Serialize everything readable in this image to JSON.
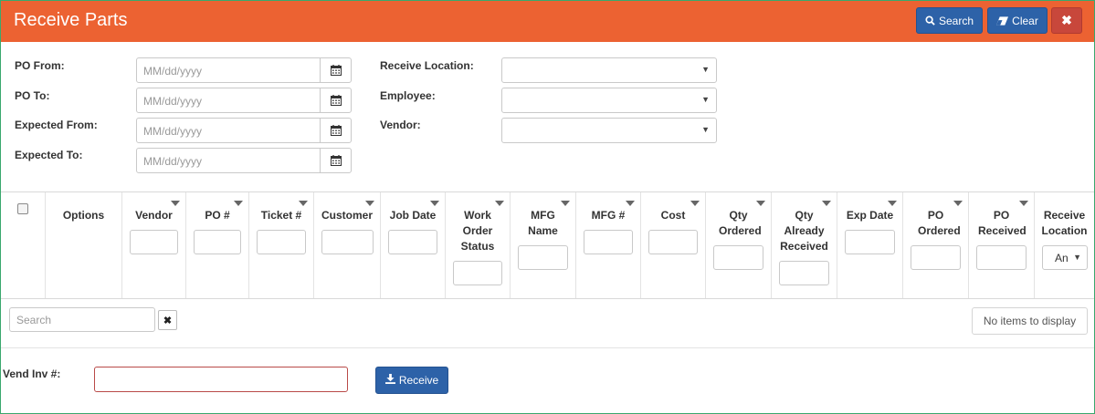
{
  "header": {
    "title": "Receive Parts",
    "search_label": "Search",
    "clear_label": "Clear",
    "close_glyph": "✖",
    "accent": "#ec6232"
  },
  "filters": {
    "po_from": {
      "label": "PO From:",
      "placeholder": "MM/dd/yyyy"
    },
    "po_to": {
      "label": "PO To:",
      "placeholder": "MM/dd/yyyy"
    },
    "expected_from": {
      "label": "Expected From:",
      "placeholder": "MM/dd/yyyy"
    },
    "expected_to": {
      "label": "Expected To:",
      "placeholder": "MM/dd/yyyy"
    },
    "receive_location": {
      "label": "Receive Location:",
      "value": ""
    },
    "employee": {
      "label": "Employee:",
      "value": ""
    },
    "vendor": {
      "label": "Vendor:",
      "value": ""
    }
  },
  "grid": {
    "columns": [
      {
        "label": "Options"
      },
      {
        "label": "Vendor"
      },
      {
        "label": "PO #"
      },
      {
        "label": "Ticket #"
      },
      {
        "label": "Customer"
      },
      {
        "label": "Job Date"
      },
      {
        "label": "Work Order Status"
      },
      {
        "label": "MFG Name"
      },
      {
        "label": "MFG #"
      },
      {
        "label": "Cost"
      },
      {
        "label": "Qty Ordered"
      },
      {
        "label": "Qty Already Received"
      },
      {
        "label": "Exp Date"
      },
      {
        "label": "PO Ordered"
      },
      {
        "label": "PO Received"
      },
      {
        "label": "Receive Location"
      }
    ],
    "receive_location_filter_value": "An",
    "search_placeholder": "Search",
    "clear_glyph": "✖",
    "empty_message": "No items to display"
  },
  "footer": {
    "vend_inv_label": "Vend Inv #:",
    "vend_inv_value": "",
    "receive_label": "Receive"
  }
}
